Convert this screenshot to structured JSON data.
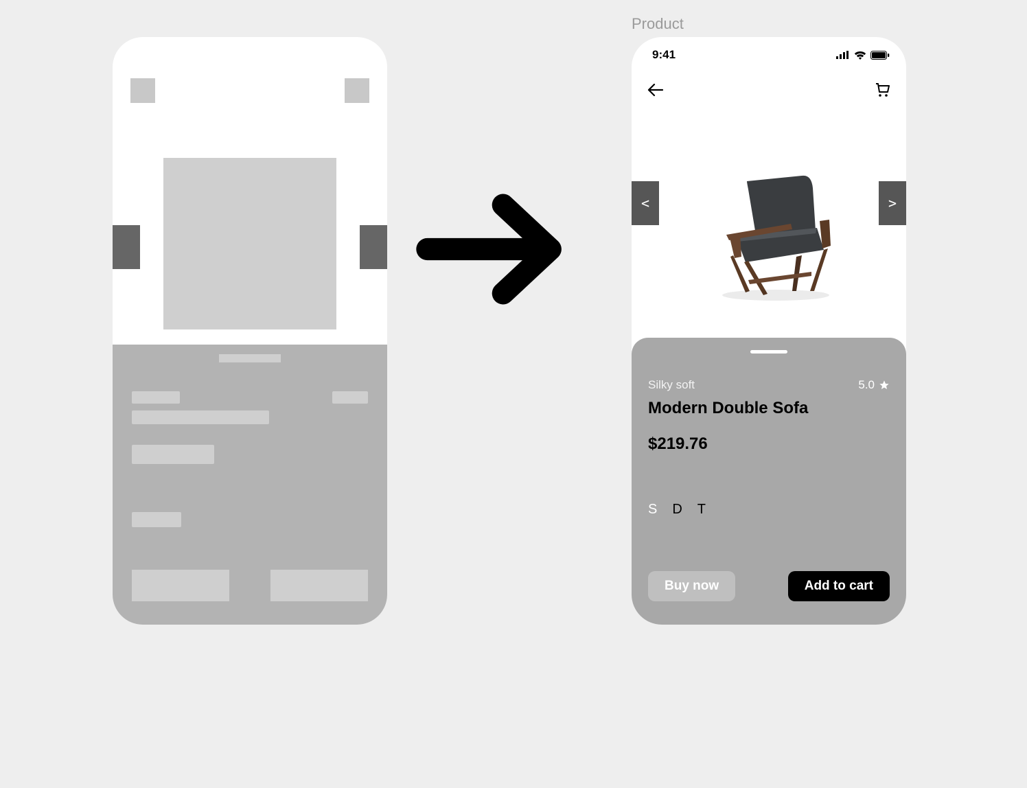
{
  "frame_label": "Product",
  "status": {
    "time": "9:41"
  },
  "product": {
    "subtitle": "Silky soft",
    "title": "Modern Double Sofa",
    "price": "$219.76",
    "rating": "5.0",
    "sizes": [
      "S",
      "D",
      "T"
    ],
    "selected_size": "S",
    "image_alt": "Modern wooden armchair with dark grey cushion"
  },
  "cta": {
    "buy": "Buy now",
    "cart": "Add to cart"
  },
  "carousel": {
    "prev": "<",
    "next": ">"
  }
}
